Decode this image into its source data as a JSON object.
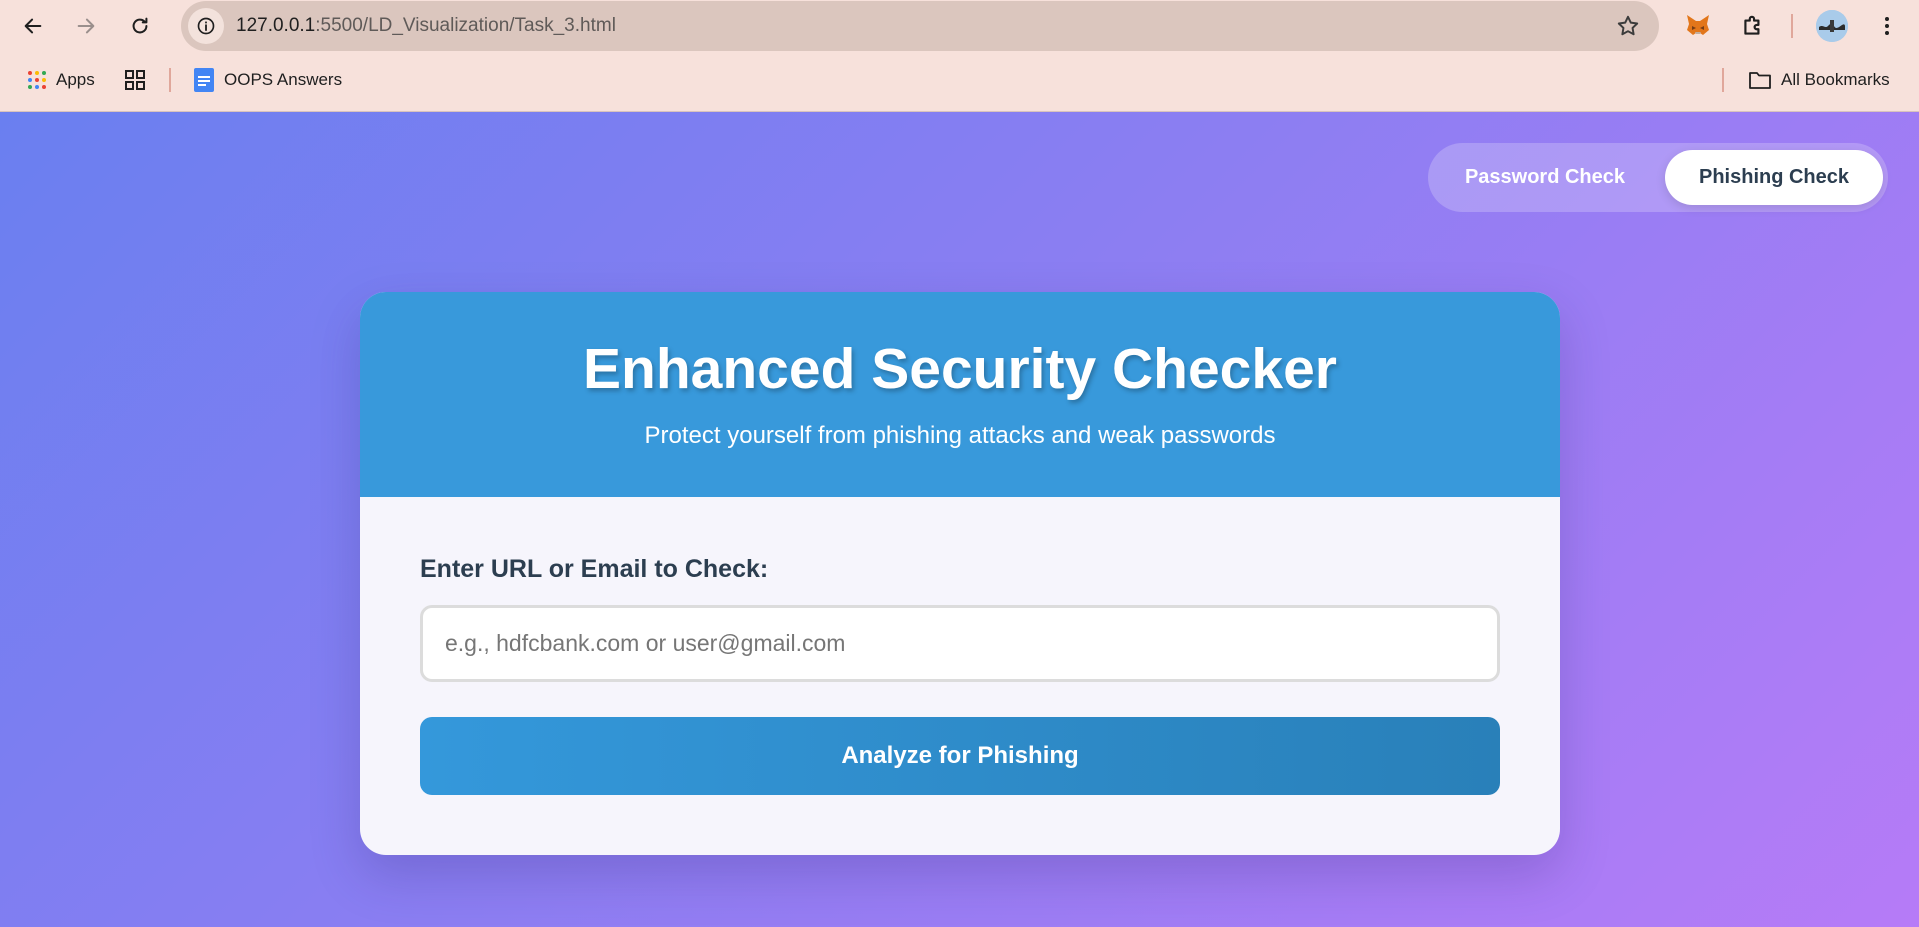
{
  "browser": {
    "url_host": "127.0.0.1",
    "url_path": ":5500/LD_Visualization/Task_3.html",
    "bookmarks": {
      "apps_label": "Apps",
      "oops_label": "OOPS Answers",
      "all_bookmarks_label": "All Bookmarks"
    }
  },
  "switcher": {
    "password_label": "Password Check",
    "phishing_label": "Phishing Check",
    "active": "Phishing Check"
  },
  "card": {
    "title": "Enhanced Security Checker",
    "subtitle": "Protect yourself from phishing attacks and weak passwords",
    "input_label": "Enter URL or Email to Check:",
    "input_placeholder": "e.g., hdfcbank.com or user@gmail.com",
    "input_value": "",
    "button_label": "Analyze for Phishing"
  },
  "colors": {
    "header_blue": "#3899db",
    "button_gradient_start": "#3498db",
    "button_gradient_end": "#2980b9",
    "text_dark": "#2c3e50",
    "page_gradient_start": "#6a7ff0",
    "page_gradient_end": "#b67bf7"
  }
}
